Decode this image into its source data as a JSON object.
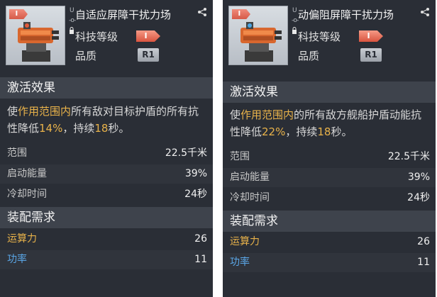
{
  "cards": [
    {
      "tier_tag": "I",
      "u_mark": "U",
      "link_mark": "-o-",
      "name": "自适应屏障干扰力场",
      "level_label": "科技等级",
      "level_value": "I",
      "quality_label": "品质",
      "quality_value": "R1",
      "effects_title": "激活效果",
      "desc": {
        "p1": "使",
        "hl1": "作用",
        "hl2": "范围内",
        "p2": "所有敌对目标护盾的所有抗性降低",
        "hl3": "14%",
        "p3": "，持续",
        "hl4": "18",
        "p4": "秒。"
      },
      "stats": [
        {
          "label": "范围",
          "value": "22.5千米"
        },
        {
          "label": "启动能量",
          "value": "39%"
        },
        {
          "label": "冷却时间",
          "value": "24秒"
        }
      ],
      "req_title": "装配需求",
      "reqs": [
        {
          "label": "运算力",
          "value": "26"
        },
        {
          "label": "功率",
          "value": "11"
        }
      ]
    },
    {
      "tier_tag": "I",
      "u_mark": "U",
      "link_mark": "-o-",
      "name": "动偏阻屏障干扰力场",
      "level_label": "科技等级",
      "level_value": "I",
      "quality_label": "品质",
      "quality_value": "R1",
      "effects_title": "激活效果",
      "desc": {
        "p1": "使",
        "hl1": "作用",
        "hl2": "范围内",
        "p2": "的所有敌方舰船护盾动能抗性降低",
        "hl3": "22%",
        "p3": "，持续",
        "hl4": "18",
        "p4": "秒。"
      },
      "stats": [
        {
          "label": "范围",
          "value": "22.5千米"
        },
        {
          "label": "启动能量",
          "value": "39%"
        },
        {
          "label": "冷却时间",
          "value": "24秒"
        }
      ],
      "req_title": "装配需求",
      "reqs": [
        {
          "label": "运算力",
          "value": "26"
        },
        {
          "label": "功率",
          "value": "11"
        }
      ]
    }
  ],
  "colors": {
    "panel": "#2a2e36",
    "section": "#3e434c",
    "highlight": "#e8b24a",
    "compute": "#e8b24a",
    "power": "#5aa6e6",
    "tier": "#d9543f"
  },
  "icons": {
    "share": "share-icon",
    "lock": "lock-icon",
    "module": "turret-module-icon"
  }
}
